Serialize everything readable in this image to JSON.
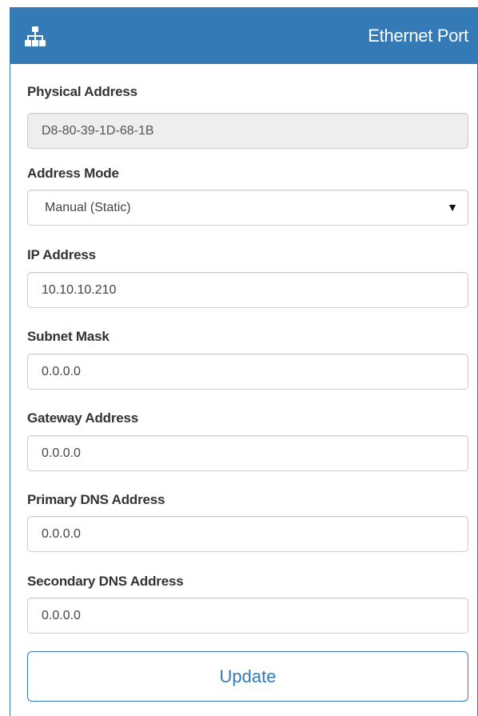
{
  "panel": {
    "title": "Ethernet Port",
    "icon": "sitemap-icon",
    "accent_color": "#337ab7"
  },
  "fields": {
    "physical_address": {
      "label": "Physical Address",
      "value": "D8-80-39-1D-68-1B"
    },
    "address_mode": {
      "label": "Address Mode",
      "value": "Manual (Static)"
    },
    "ip_address": {
      "label": "IP Address",
      "value": "10.10.10.210"
    },
    "subnet_mask": {
      "label": "Subnet Mask",
      "value": "0.0.0.0"
    },
    "gateway_address": {
      "label": "Gateway Address",
      "value": "0.0.0.0"
    },
    "primary_dns": {
      "label": "Primary DNS Address",
      "value": "0.0.0.0"
    },
    "secondary_dns": {
      "label": "Secondary DNS Address",
      "value": "0.0.0.0"
    }
  },
  "actions": {
    "update_label": "Update"
  }
}
